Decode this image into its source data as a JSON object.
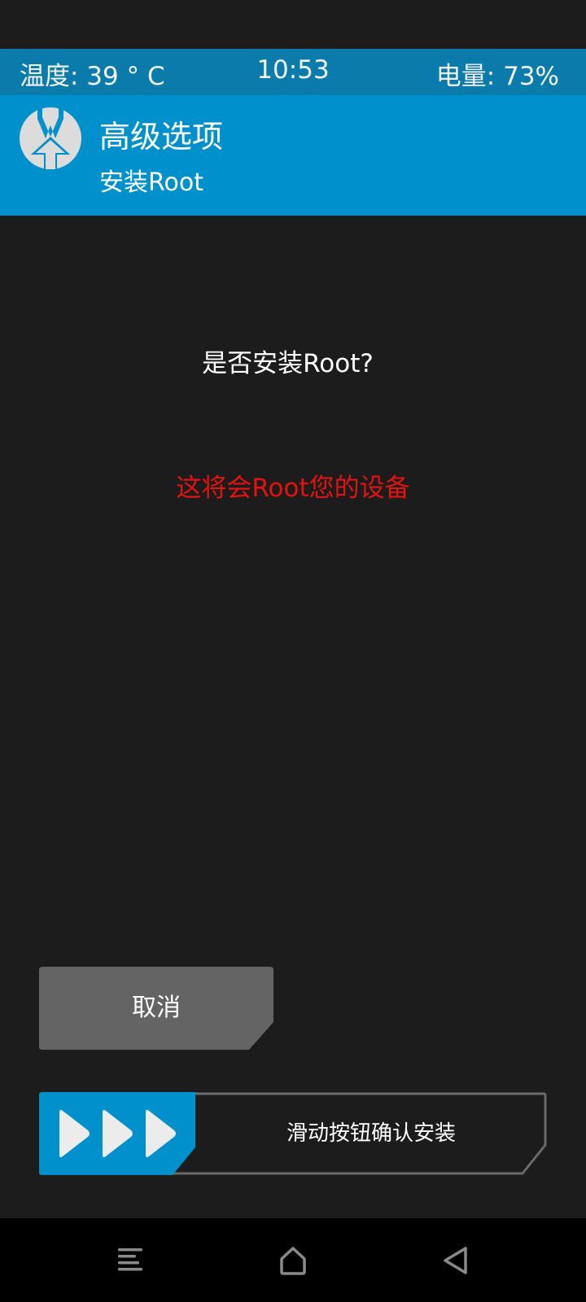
{
  "status_bar": {
    "temperature": "温度: 39 ° C",
    "time": "10:53",
    "battery": "电量: 73%"
  },
  "header": {
    "logo_icon": "twrp-logo-icon",
    "title": "高级选项",
    "subtitle": "安装Root"
  },
  "dialog": {
    "question": "是否安装Root?",
    "warning": "这将会Root您的设备"
  },
  "cancel_button": {
    "label": "取消"
  },
  "swipe_slider": {
    "handle_icon": "triple-arrow-right-icon",
    "label": "滑动按钮确认安装"
  },
  "nav_bar": {
    "menu_icon": "menu-icon",
    "home_icon": "home-icon",
    "back_icon": "back-icon"
  },
  "colors": {
    "status_bar": "#0a7bab",
    "header": "#0090cb",
    "background": "#1c1c1c",
    "warning": "#e4130f",
    "button": "#646464"
  }
}
